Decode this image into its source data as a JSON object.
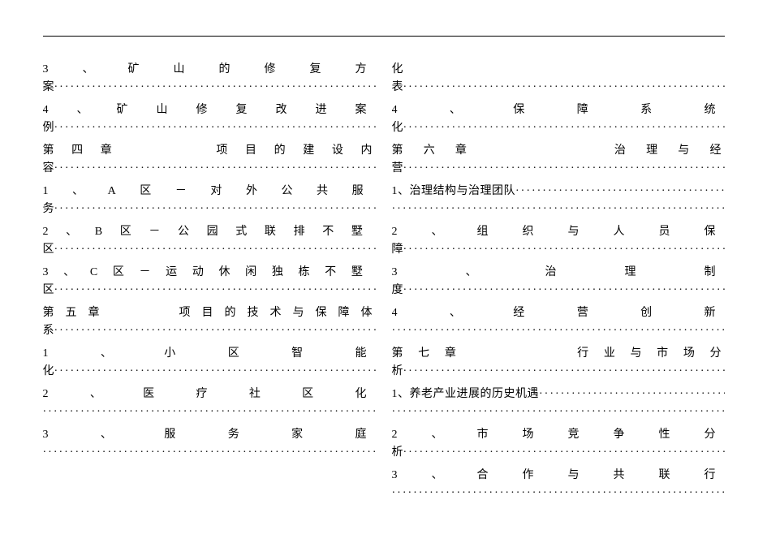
{
  "toc": {
    "left": [
      {
        "title": "3、矿山的修复方",
        "wrap": "案"
      },
      {
        "title": "4、矿山修复改进案",
        "wrap": "例"
      },
      {
        "title": "第四章　　　项目的建设内",
        "wrap": "容"
      },
      {
        "title": "1、A区－对外公共服",
        "wrap": "务"
      },
      {
        "title": "2、B区－公园式联排不墅",
        "wrap": "区"
      },
      {
        "title": "3、C区－运动休闲独栋不墅",
        "wrap": "区"
      },
      {
        "title": "第五章　　　项目的技术与保障体",
        "wrap": "系"
      },
      {
        "title": "1、小区智能",
        "wrap": "化"
      },
      {
        "title": "2、医疗社区化",
        "wrap": ""
      },
      {
        "title": "3、服务家庭",
        "wrap": ""
      }
    ],
    "right": [
      {
        "title": "化",
        "wrap": "表"
      },
      {
        "title": "4、保障系统",
        "wrap": "化"
      },
      {
        "title": "第六章　　　　治理与经",
        "wrap": "营"
      },
      {
        "title": "1、治理结构与治理团队",
        "wrap": ""
      },
      {
        "title": "2、组织与人员保",
        "wrap": "障"
      },
      {
        "title": "3、治理制",
        "wrap": "度"
      },
      {
        "title": "4、经营创新",
        "wrap": ""
      },
      {
        "title": "第七章　　　　行业与市场分",
        "wrap": "析"
      },
      {
        "title": "1、养老产业进展的历史机遇",
        "wrap": ""
      },
      {
        "title": "2、市场竞争性分",
        "wrap": "析"
      },
      {
        "title": "3、合作与共联行",
        "wrap": ""
      }
    ]
  }
}
